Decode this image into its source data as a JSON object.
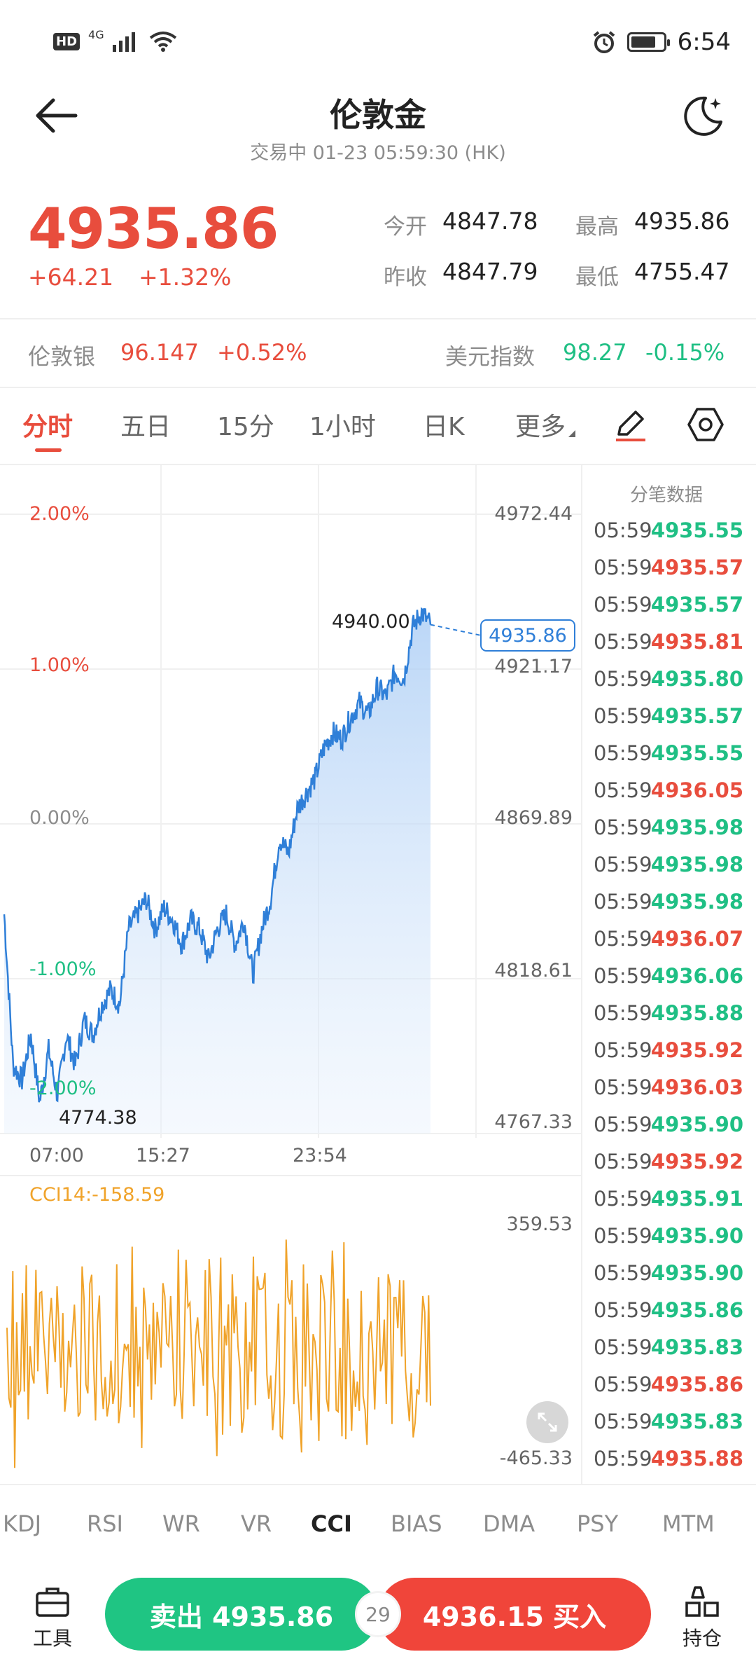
{
  "status_bar": {
    "hd": "HD",
    "net": "4G",
    "time": "6:54"
  },
  "header": {
    "title": "伦敦金",
    "subtitle": "交易中  01-23 05:59:30 (HK)"
  },
  "quote": {
    "price": "4935.86",
    "change": "+64.21",
    "change_pct": "+1.32%",
    "open_label": "今开",
    "open": "4847.78",
    "high_label": "最高",
    "high": "4935.86",
    "prev_label": "昨收",
    "prev": "4847.79",
    "low_label": "最低",
    "low": "4755.47"
  },
  "related": {
    "silver_label": "伦敦银",
    "silver_price": "96.147",
    "silver_pct": "+0.52%",
    "usd_label": "美元指数",
    "usd_price": "98.27",
    "usd_pct": "-0.15%"
  },
  "tabs": [
    "分时",
    "五日",
    "15分",
    "1小时",
    "日K",
    "更多"
  ],
  "chart": {
    "pct_labels": [
      "2.00%",
      "1.00%",
      "0.00%",
      "-1.00%",
      "-2.00%"
    ],
    "price_labels": [
      "4972.44",
      "4921.17",
      "4869.89",
      "4818.61",
      "4767.33"
    ],
    "time_labels": [
      "07:00",
      "15:27",
      "23:54"
    ],
    "high_marker": "4940.00",
    "low_marker": "4774.38",
    "current_tag": "4935.86",
    "indicator_label": "CCI14:-158.59",
    "cci_max": "359.53",
    "cci_min": "-465.33"
  },
  "chart_data": {
    "type": "line",
    "title": "",
    "xlabel": "",
    "ylabel": "",
    "x": [
      "07:00",
      "15:27",
      "23:54"
    ],
    "ylim": [
      4767.33,
      4972.44
    ],
    "series": [
      {
        "values": [
          4840,
          4790,
          4785,
          4800,
          4778,
          4795,
          4780,
          4800,
          4790,
          4805,
          4800,
          4810,
          4815,
          4810,
          4835,
          4840,
          4845,
          4835,
          4842,
          4838,
          4830,
          4838,
          4835,
          4825,
          4835,
          4840,
          4830,
          4838,
          4820,
          4835,
          4845,
          4865,
          4860,
          4875,
          4880,
          4885,
          4895,
          4900,
          4898,
          4905,
          4910,
          4906,
          4915,
          4912,
          4920,
          4918,
          4935,
          4940,
          4935.86
        ]
      }
    ]
  },
  "ticks": {
    "header": "分笔数据",
    "rows": [
      {
        "time": "05:59",
        "price": "4935.55",
        "dir": "down"
      },
      {
        "time": "05:59",
        "price": "4935.57",
        "dir": "up"
      },
      {
        "time": "05:59",
        "price": "4935.57",
        "dir": "down"
      },
      {
        "time": "05:59",
        "price": "4935.81",
        "dir": "up"
      },
      {
        "time": "05:59",
        "price": "4935.80",
        "dir": "down"
      },
      {
        "time": "05:59",
        "price": "4935.57",
        "dir": "down"
      },
      {
        "time": "05:59",
        "price": "4935.55",
        "dir": "down"
      },
      {
        "time": "05:59",
        "price": "4936.05",
        "dir": "up"
      },
      {
        "time": "05:59",
        "price": "4935.98",
        "dir": "down"
      },
      {
        "time": "05:59",
        "price": "4935.98",
        "dir": "down"
      },
      {
        "time": "05:59",
        "price": "4935.98",
        "dir": "down"
      },
      {
        "time": "05:59",
        "price": "4936.07",
        "dir": "up"
      },
      {
        "time": "05:59",
        "price": "4936.06",
        "dir": "down"
      },
      {
        "time": "05:59",
        "price": "4935.88",
        "dir": "down"
      },
      {
        "time": "05:59",
        "price": "4935.92",
        "dir": "up"
      },
      {
        "time": "05:59",
        "price": "4936.03",
        "dir": "up"
      },
      {
        "time": "05:59",
        "price": "4935.90",
        "dir": "down"
      },
      {
        "time": "05:59",
        "price": "4935.92",
        "dir": "up"
      },
      {
        "time": "05:59",
        "price": "4935.91",
        "dir": "down"
      },
      {
        "time": "05:59",
        "price": "4935.90",
        "dir": "down"
      },
      {
        "time": "05:59",
        "price": "4935.90",
        "dir": "down"
      },
      {
        "time": "05:59",
        "price": "4935.86",
        "dir": "down"
      },
      {
        "time": "05:59",
        "price": "4935.83",
        "dir": "down"
      },
      {
        "time": "05:59",
        "price": "4935.86",
        "dir": "up"
      },
      {
        "time": "05:59",
        "price": "4935.83",
        "dir": "down"
      },
      {
        "time": "05:59",
        "price": "4935.88",
        "dir": "up"
      }
    ]
  },
  "indicators": [
    "KDJ",
    "RSI",
    "WR",
    "VR",
    "CCI",
    "BIAS",
    "DMA",
    "PSY",
    "MTM"
  ],
  "bottom": {
    "tool_label": "工具",
    "sell_label": "卖出 4935.86",
    "spread": "29",
    "buy_label": "4936.15 买入",
    "position_label": "持仓"
  },
  "colors": {
    "up": "#e84d3d",
    "down": "#1fbf84",
    "line": "#2f7fd8",
    "cci": "#f0a32a"
  }
}
